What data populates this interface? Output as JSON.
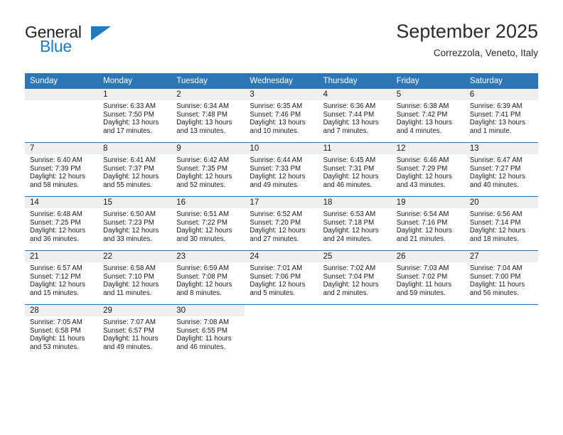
{
  "brand": {
    "name_part1": "General",
    "name_part2": "Blue",
    "accent_color": "#1f7ac0"
  },
  "header": {
    "title": "September 2025",
    "location": "Correzzola, Veneto, Italy"
  },
  "calendar": {
    "header_background": "#2d76b6",
    "daynum_background": "#efefef",
    "weekday_headers": [
      "Sunday",
      "Monday",
      "Tuesday",
      "Wednesday",
      "Thursday",
      "Friday",
      "Saturday"
    ],
    "weeks": [
      [
        {
          "day": "",
          "empty": true
        },
        {
          "day": "1",
          "sunrise": "Sunrise: 6:33 AM",
          "sunset": "Sunset: 7:50 PM",
          "daylight": "Daylight: 13 hours and 17 minutes."
        },
        {
          "day": "2",
          "sunrise": "Sunrise: 6:34 AM",
          "sunset": "Sunset: 7:48 PM",
          "daylight": "Daylight: 13 hours and 13 minutes."
        },
        {
          "day": "3",
          "sunrise": "Sunrise: 6:35 AM",
          "sunset": "Sunset: 7:46 PM",
          "daylight": "Daylight: 13 hours and 10 minutes."
        },
        {
          "day": "4",
          "sunrise": "Sunrise: 6:36 AM",
          "sunset": "Sunset: 7:44 PM",
          "daylight": "Daylight: 13 hours and 7 minutes."
        },
        {
          "day": "5",
          "sunrise": "Sunrise: 6:38 AM",
          "sunset": "Sunset: 7:42 PM",
          "daylight": "Daylight: 13 hours and 4 minutes."
        },
        {
          "day": "6",
          "sunrise": "Sunrise: 6:39 AM",
          "sunset": "Sunset: 7:41 PM",
          "daylight": "Daylight: 13 hours and 1 minute."
        }
      ],
      [
        {
          "day": "7",
          "sunrise": "Sunrise: 6:40 AM",
          "sunset": "Sunset: 7:39 PM",
          "daylight": "Daylight: 12 hours and 58 minutes."
        },
        {
          "day": "8",
          "sunrise": "Sunrise: 6:41 AM",
          "sunset": "Sunset: 7:37 PM",
          "daylight": "Daylight: 12 hours and 55 minutes."
        },
        {
          "day": "9",
          "sunrise": "Sunrise: 6:42 AM",
          "sunset": "Sunset: 7:35 PM",
          "daylight": "Daylight: 12 hours and 52 minutes."
        },
        {
          "day": "10",
          "sunrise": "Sunrise: 6:44 AM",
          "sunset": "Sunset: 7:33 PM",
          "daylight": "Daylight: 12 hours and 49 minutes."
        },
        {
          "day": "11",
          "sunrise": "Sunrise: 6:45 AM",
          "sunset": "Sunset: 7:31 PM",
          "daylight": "Daylight: 12 hours and 46 minutes."
        },
        {
          "day": "12",
          "sunrise": "Sunrise: 6:46 AM",
          "sunset": "Sunset: 7:29 PM",
          "daylight": "Daylight: 12 hours and 43 minutes."
        },
        {
          "day": "13",
          "sunrise": "Sunrise: 6:47 AM",
          "sunset": "Sunset: 7:27 PM",
          "daylight": "Daylight: 12 hours and 40 minutes."
        }
      ],
      [
        {
          "day": "14",
          "sunrise": "Sunrise: 6:48 AM",
          "sunset": "Sunset: 7:25 PM",
          "daylight": "Daylight: 12 hours and 36 minutes."
        },
        {
          "day": "15",
          "sunrise": "Sunrise: 6:50 AM",
          "sunset": "Sunset: 7:23 PM",
          "daylight": "Daylight: 12 hours and 33 minutes."
        },
        {
          "day": "16",
          "sunrise": "Sunrise: 6:51 AM",
          "sunset": "Sunset: 7:22 PM",
          "daylight": "Daylight: 12 hours and 30 minutes."
        },
        {
          "day": "17",
          "sunrise": "Sunrise: 6:52 AM",
          "sunset": "Sunset: 7:20 PM",
          "daylight": "Daylight: 12 hours and 27 minutes."
        },
        {
          "day": "18",
          "sunrise": "Sunrise: 6:53 AM",
          "sunset": "Sunset: 7:18 PM",
          "daylight": "Daylight: 12 hours and 24 minutes."
        },
        {
          "day": "19",
          "sunrise": "Sunrise: 6:54 AM",
          "sunset": "Sunset: 7:16 PM",
          "daylight": "Daylight: 12 hours and 21 minutes."
        },
        {
          "day": "20",
          "sunrise": "Sunrise: 6:56 AM",
          "sunset": "Sunset: 7:14 PM",
          "daylight": "Daylight: 12 hours and 18 minutes."
        }
      ],
      [
        {
          "day": "21",
          "sunrise": "Sunrise: 6:57 AM",
          "sunset": "Sunset: 7:12 PM",
          "daylight": "Daylight: 12 hours and 15 minutes."
        },
        {
          "day": "22",
          "sunrise": "Sunrise: 6:58 AM",
          "sunset": "Sunset: 7:10 PM",
          "daylight": "Daylight: 12 hours and 11 minutes."
        },
        {
          "day": "23",
          "sunrise": "Sunrise: 6:59 AM",
          "sunset": "Sunset: 7:08 PM",
          "daylight": "Daylight: 12 hours and 8 minutes."
        },
        {
          "day": "24",
          "sunrise": "Sunrise: 7:01 AM",
          "sunset": "Sunset: 7:06 PM",
          "daylight": "Daylight: 12 hours and 5 minutes."
        },
        {
          "day": "25",
          "sunrise": "Sunrise: 7:02 AM",
          "sunset": "Sunset: 7:04 PM",
          "daylight": "Daylight: 12 hours and 2 minutes."
        },
        {
          "day": "26",
          "sunrise": "Sunrise: 7:03 AM",
          "sunset": "Sunset: 7:02 PM",
          "daylight": "Daylight: 11 hours and 59 minutes."
        },
        {
          "day": "27",
          "sunrise": "Sunrise: 7:04 AM",
          "sunset": "Sunset: 7:00 PM",
          "daylight": "Daylight: 11 hours and 56 minutes."
        }
      ],
      [
        {
          "day": "28",
          "sunrise": "Sunrise: 7:05 AM",
          "sunset": "Sunset: 6:58 PM",
          "daylight": "Daylight: 11 hours and 53 minutes."
        },
        {
          "day": "29",
          "sunrise": "Sunrise: 7:07 AM",
          "sunset": "Sunset: 6:57 PM",
          "daylight": "Daylight: 11 hours and 49 minutes."
        },
        {
          "day": "30",
          "sunrise": "Sunrise: 7:08 AM",
          "sunset": "Sunset: 6:55 PM",
          "daylight": "Daylight: 11 hours and 46 minutes."
        },
        {
          "day": "",
          "empty": true,
          "blank": true
        },
        {
          "day": "",
          "empty": true,
          "blank": true
        },
        {
          "day": "",
          "empty": true,
          "blank": true
        },
        {
          "day": "",
          "empty": true,
          "blank": true
        }
      ]
    ]
  }
}
